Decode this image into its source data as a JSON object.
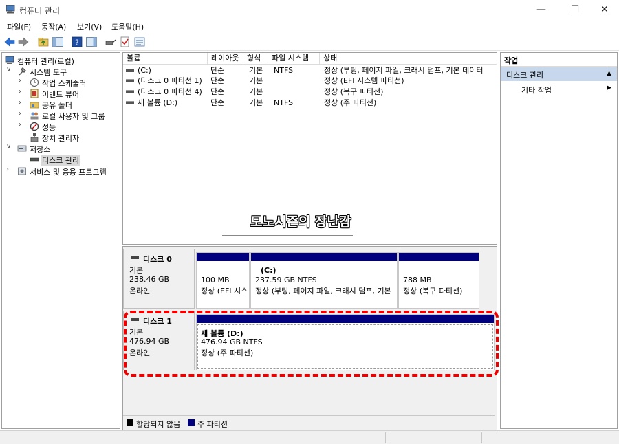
{
  "window": {
    "title": "컴퓨터 관리",
    "minimize": "—",
    "maximize": "☐",
    "close": "✕"
  },
  "menu": [
    "파일(F)",
    "동작(A)",
    "보기(V)",
    "도움말(H)"
  ],
  "tree": [
    {
      "label": "컴퓨터 관리(로컬)",
      "icon": "computer-management-icon"
    },
    {
      "label": "시스템 도구",
      "icon": "system-tools-icon"
    },
    {
      "label": "작업 스케줄러",
      "icon": "task-scheduler-icon"
    },
    {
      "label": "이벤트 뷰어",
      "icon": "event-viewer-icon"
    },
    {
      "label": "공유 폴더",
      "icon": "shared-folders-icon"
    },
    {
      "label": "로컬 사용자 및 그룹",
      "icon": "local-users-icon"
    },
    {
      "label": "성능",
      "icon": "performance-icon"
    },
    {
      "label": "장치 관리자",
      "icon": "device-manager-icon"
    },
    {
      "label": "저장소",
      "icon": "storage-icon"
    },
    {
      "label": "디스크 관리",
      "icon": "disk-management-icon"
    },
    {
      "label": "서비스 및 응용 프로그램",
      "icon": "services-apps-icon"
    }
  ],
  "volume_list": {
    "headers": [
      "볼륨",
      "레이아웃",
      "형식",
      "파일 시스템",
      "상태"
    ],
    "rows": [
      {
        "volume": "(C:)",
        "layout": "단순",
        "type": "기본",
        "fs": "NTFS",
        "status": "정상 (부팅, 페이지 파일, 크래시 덤프, 기본 데이터"
      },
      {
        "volume": "(디스크 0 파티션 1)",
        "layout": "단순",
        "type": "기본",
        "fs": "",
        "status": "정상 (EFI 시스템 파티션)"
      },
      {
        "volume": "(디스크 0 파티션 4)",
        "layout": "단순",
        "type": "기본",
        "fs": "",
        "status": "정상 (복구 파티션)"
      },
      {
        "volume": "새 볼륨 (D:)",
        "layout": "단순",
        "type": "기본",
        "fs": "NTFS",
        "status": "정상 (주 파티션)"
      }
    ]
  },
  "watermark": "모노시즌의 장난감",
  "disks": [
    {
      "name": "디스크 0",
      "kind": "기본",
      "size": "238.46 GB",
      "state": "온라인",
      "partitions": [
        {
          "name": "",
          "size": "100 MB",
          "status": "정상 (EFI 시스"
        },
        {
          "name": "(C:)",
          "size": "237.59 GB NTFS",
          "status": "정상 (부팅, 페이지 파일, 크래시 덤프, 기본"
        },
        {
          "name": "",
          "size": "788 MB",
          "status": "정상 (복구 파티션)"
        }
      ]
    },
    {
      "name": "디스크 1",
      "kind": "기본",
      "size": "476.94 GB",
      "state": "온라인",
      "partitions": [
        {
          "name": "새 볼륨  (D:)",
          "size": "476.94 GB NTFS",
          "status": "정상 (주 파티션)"
        }
      ]
    }
  ],
  "legend": [
    {
      "label": "할당되지 않음",
      "color": "#000000"
    },
    {
      "label": "주 파티션",
      "color": "#00007f"
    }
  ],
  "actions": {
    "header": "작업",
    "section": "디스크 관리",
    "item": "기타 작업"
  },
  "colors": {
    "partition_bar": "#00007f",
    "actions_section_bg": "#c7d8ed",
    "highlight_dash": "#e00000"
  }
}
